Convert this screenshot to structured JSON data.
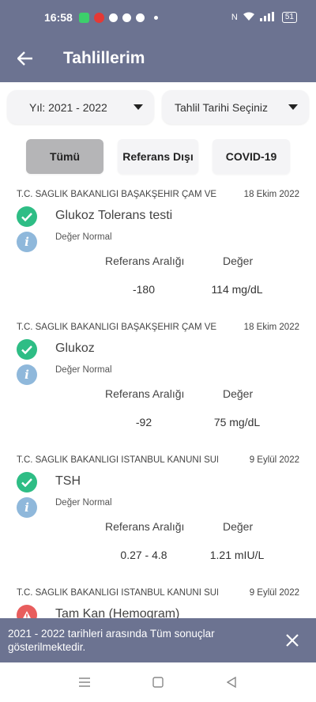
{
  "status_bar": {
    "time": "16:58",
    "battery": "51"
  },
  "app_bar": {
    "back_icon": "arrow-left",
    "title": "Tahlillerim"
  },
  "filters": {
    "year_value": "Yıl: 2021 - 2022",
    "date_value": "Tahlil Tarihi Seçiniz"
  },
  "tabs": [
    {
      "label": "Tümü",
      "active": true
    },
    {
      "label": "Referans Dışı",
      "active": false
    },
    {
      "label": "COVID-19",
      "active": false
    }
  ],
  "results": [
    {
      "institution": "T.C. SAĞLIK BAKANLIĞI BAŞAKŞEHİR ÇAM VE",
      "date": "18 Ekim 2022",
      "status": "normal",
      "name": "Glukoz Tolerans testi",
      "note": "Değer Normal",
      "ref_header": "Referans Aralığı",
      "val_header": "Değer",
      "ref_value": "-180",
      "value": "114 mg/dL"
    },
    {
      "institution": "T.C. SAĞLIK BAKANLIĞI BAŞAKŞEHİR ÇAM VE",
      "date": "18 Ekim 2022",
      "status": "normal",
      "name": "Glukoz",
      "note": "Değer Normal",
      "ref_header": "Referans Aralığı",
      "val_header": "Değer",
      "ref_value": "-92",
      "value": "75 mg/dL"
    },
    {
      "institution": "T.C. SAĞLIK BAKANLIĞI İSTANBUL KANUNİ SULTAN",
      "date": "9 Eylül 2022",
      "status": "normal",
      "name": "TSH",
      "note": "Değer Normal",
      "ref_header": "Referans Aralığı",
      "val_header": "Değer",
      "ref_value": "0.27 - 4.8",
      "value": "1.21 mIU/L"
    },
    {
      "institution": "T.C. SAĞLIK BAKANLIĞI İSTANBUL KANUNİ SULTAN",
      "date": "9 Eylül 2022",
      "status": "warning",
      "name": "Tam Kan (Hemogram)"
    }
  ],
  "snackbar": {
    "message": "2021 - 2022 tarihleri arasında Tüm sonuçlar gösterilmektedir."
  },
  "colors": {
    "primary": "#6c7391",
    "success": "#2ebd85",
    "warning": "#e85d5d",
    "info": "#8fb8db"
  }
}
